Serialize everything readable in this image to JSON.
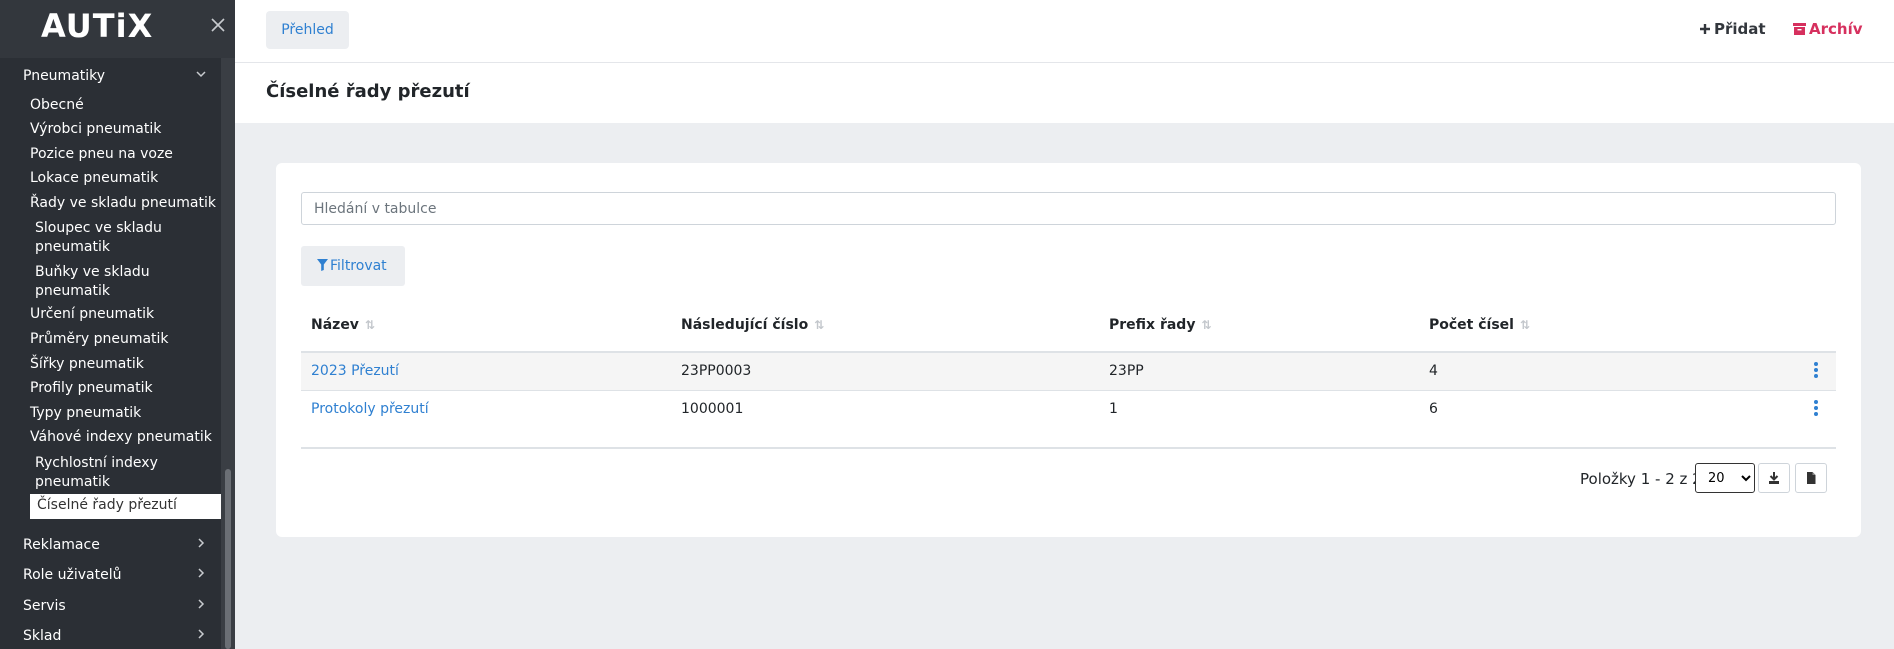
{
  "app": {
    "logo": "AUTiX"
  },
  "sidebar": {
    "groups": [
      {
        "label": "Pneumatiky"
      },
      {
        "label": "Reklamace"
      },
      {
        "label": "Role uživatelů"
      },
      {
        "label": "Servis"
      },
      {
        "label": "Sklad"
      }
    ],
    "items": [
      {
        "label": "Obecné"
      },
      {
        "label": "Výrobci pneumatik"
      },
      {
        "label": "Pozice pneu na voze"
      },
      {
        "label": "Lokace pneumatik"
      },
      {
        "label": "Řady ve skladu pneumatik"
      },
      {
        "label": "Sloupec ve skladu pneumatik"
      },
      {
        "label": "Buňky ve skladu pneumatik"
      },
      {
        "label": "Určení pneumatik"
      },
      {
        "label": "Průměry pneumatik"
      },
      {
        "label": "Šířky pneumatik"
      },
      {
        "label": "Profily pneumatik"
      },
      {
        "label": "Typy pneumatik"
      },
      {
        "label": "Váhové indexy pneumatik"
      },
      {
        "label": "Rychlostní indexy pneumatik"
      },
      {
        "label": "Číselné řady přezutí"
      }
    ]
  },
  "topbar": {
    "tab": "Přehled",
    "add": "Přidat",
    "archive": "Archív"
  },
  "page": {
    "title": "Číselné řady přezutí"
  },
  "search": {
    "placeholder": "Hledání v tabulce"
  },
  "filter": {
    "label": "Filtrovat"
  },
  "table": {
    "headers": [
      "Název",
      "Následující číslo",
      "Prefix řady",
      "Počet čísel"
    ],
    "rows": [
      [
        "2023 Přezutí",
        "23PP0003",
        "23PP",
        "4"
      ],
      [
        "Protokoly přezutí",
        "1000001",
        "1",
        "6"
      ]
    ]
  },
  "pager": {
    "text": "Položky 1 - 2 z 2",
    "page_size": "20",
    "page_size_options": [
      "20"
    ]
  },
  "colors": {
    "accent": "#2f80d1",
    "archive": "#d6305e",
    "sidebar": "#2b2f35"
  }
}
